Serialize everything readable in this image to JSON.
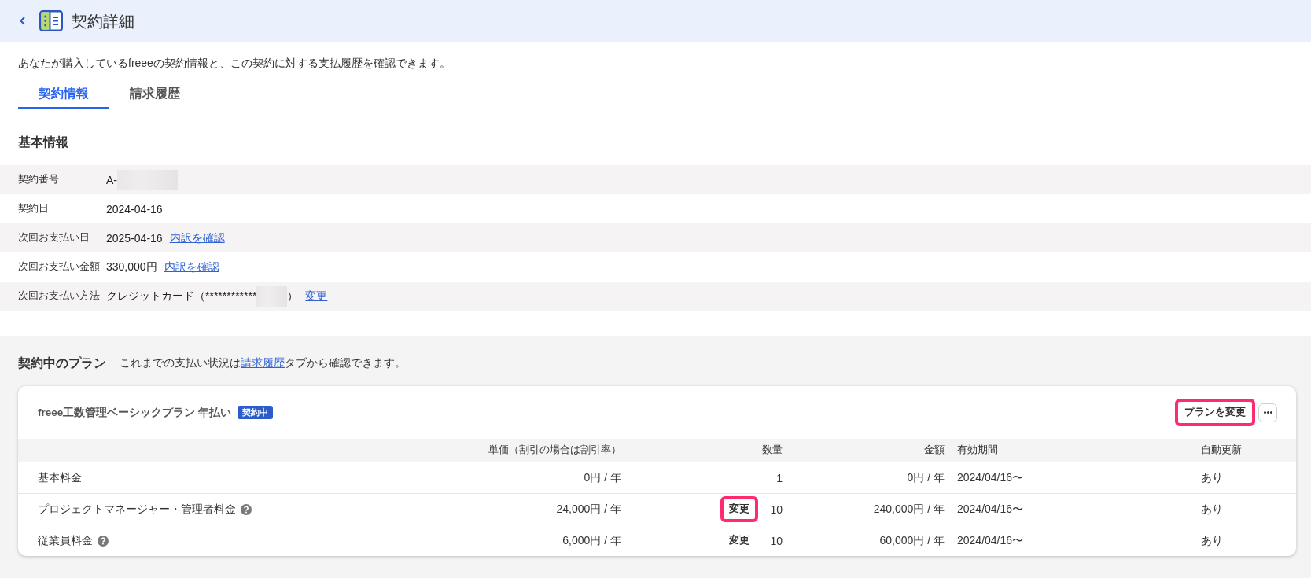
{
  "header": {
    "title": "契約詳細"
  },
  "description": "あなたが購入しているfreeeの契約情報と、この契約に対する支払履歴を確認できます。",
  "tabs": [
    {
      "label": "契約情報",
      "selected": true
    },
    {
      "label": "請求履歴",
      "selected": false
    }
  ],
  "basic_info": {
    "heading": "基本情報",
    "rows": [
      {
        "label": "契約番号",
        "value": "A-",
        "redacted": true
      },
      {
        "label": "契約日",
        "value": "2024-04-16",
        "redacted": false
      },
      {
        "label": "次回お支払い日",
        "value": "2025-04-16",
        "redacted": false,
        "link": "内訳を確認"
      },
      {
        "label": "次回お支払い金額",
        "value": "330,000円",
        "redacted": false,
        "link": "内訳を確認"
      },
      {
        "label": "次回お支払い方法",
        "value": "クレジットカード（************",
        "redacted": true,
        "value_end": "）",
        "link": "変更"
      }
    ]
  },
  "plans": {
    "heading": "契約中のプラン",
    "note_before": "これまでの支払い状況は",
    "note_link": "請求履歴",
    "note_after": "タブから確認できます。",
    "card": {
      "title": "freee工数管理ベーシックプラン 年払い",
      "badge": "契約中",
      "change_button": {
        "label": "プランを変更",
        "highlighted": true
      },
      "columns": [
        "単価（割引の場合は割引率）",
        "数量",
        "金額",
        "有効期間",
        "自動更新"
      ],
      "rows": [
        {
          "name": "基本料金",
          "help": false,
          "unit_price": "0円 / 年",
          "quantity": "1",
          "amount": "0円 / 年",
          "period": "2024/04/16〜",
          "auto_renew": "あり"
        },
        {
          "name": "プロジェクトマネージャー・管理者料金",
          "help": true,
          "unit_price": "24,000円 / 年",
          "change_button": {
            "label": "変更",
            "highlighted": true
          },
          "quantity": "10",
          "amount": "240,000円 / 年",
          "period": "2024/04/16〜",
          "auto_renew": "あり"
        },
        {
          "name": "従業員料金",
          "help": true,
          "unit_price": "6,000円 / 年",
          "change_button": {
            "label": "変更",
            "highlighted": false
          },
          "quantity": "10",
          "amount": "60,000円 / 年",
          "period": "2024/04/16〜",
          "auto_renew": "あり"
        }
      ]
    }
  }
}
